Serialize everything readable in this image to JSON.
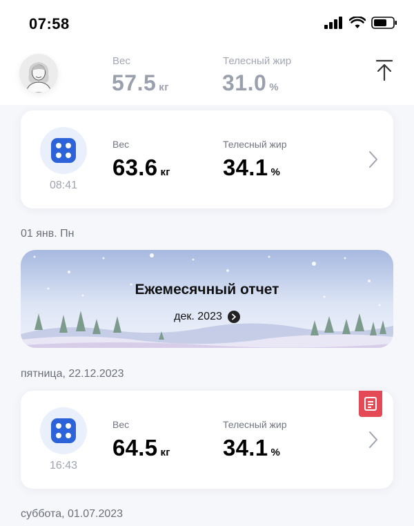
{
  "status_bar": {
    "time": "07:58"
  },
  "summary": {
    "weight_label": "Вес",
    "weight_value": "57.5",
    "weight_unit": "кг",
    "fat_label": "Телесный жир",
    "fat_value": "31.0",
    "fat_unit": "%"
  },
  "entries": [
    {
      "time": "08:41",
      "weight_label": "Вес",
      "weight_value": "63.6",
      "weight_unit": "кг",
      "fat_label": "Телесный жир",
      "fat_value": "34.1",
      "fat_unit": "%"
    },
    {
      "time": "16:43",
      "weight_label": "Вес",
      "weight_value": "64.5",
      "weight_unit": "кг",
      "fat_label": "Телесный жир",
      "fat_value": "34.1",
      "fat_unit": "%"
    }
  ],
  "dates": {
    "first": "01 янв. Пн",
    "second": "пятница, 22.12.2023",
    "third": "суббота, 01.07.2023"
  },
  "banner": {
    "title": "Ежемесячный отчет",
    "subtitle": "дек. 2023"
  },
  "colors": {
    "accent_blue": "#2d63d8",
    "report_red": "#e44a55"
  }
}
